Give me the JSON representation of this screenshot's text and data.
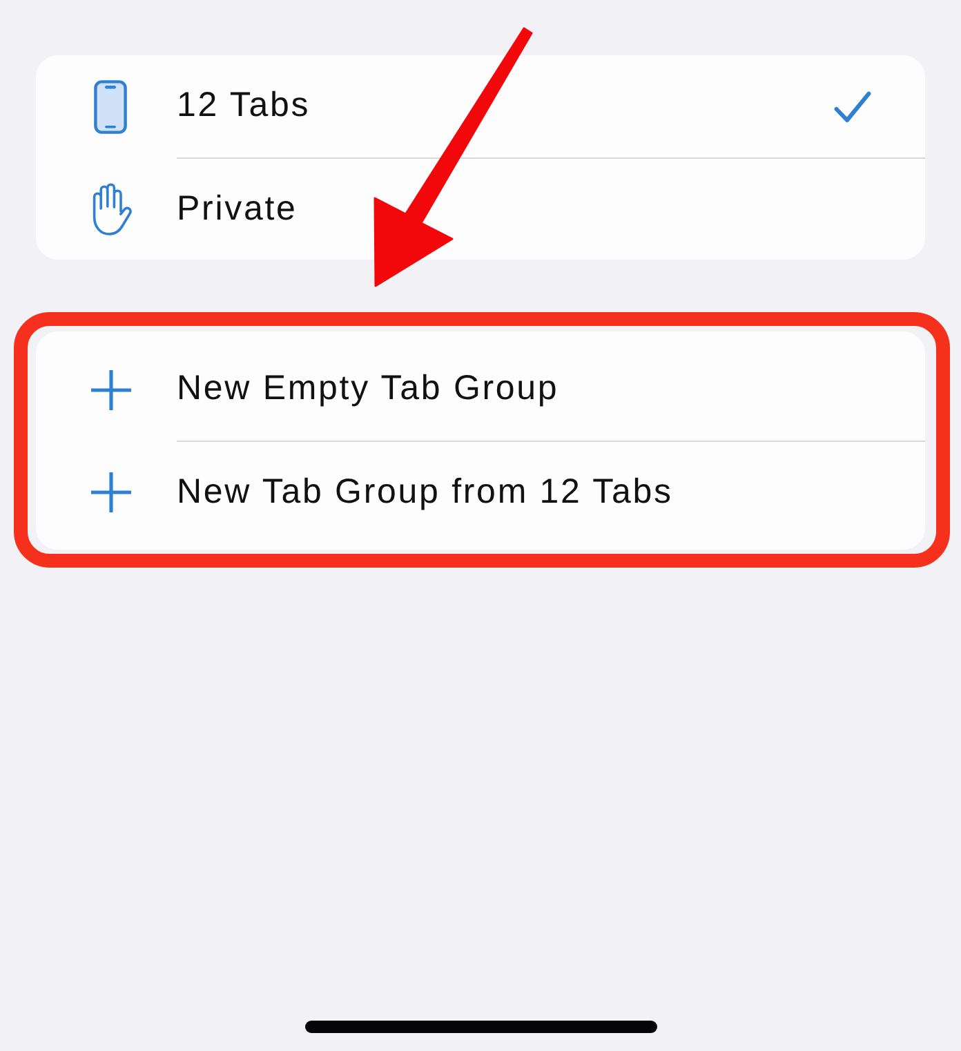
{
  "sections": [
    {
      "highlighted": false,
      "items": [
        {
          "kind": "phone",
          "label": "12 Tabs",
          "selected": true
        },
        {
          "kind": "hand",
          "label": "Private",
          "selected": false
        }
      ]
    },
    {
      "highlighted": true,
      "items": [
        {
          "kind": "plus",
          "label": "New Empty Tab Group"
        },
        {
          "kind": "plus",
          "label": "New Tab Group from 12 Tabs"
        }
      ]
    }
  ],
  "annotation_arrow": true
}
